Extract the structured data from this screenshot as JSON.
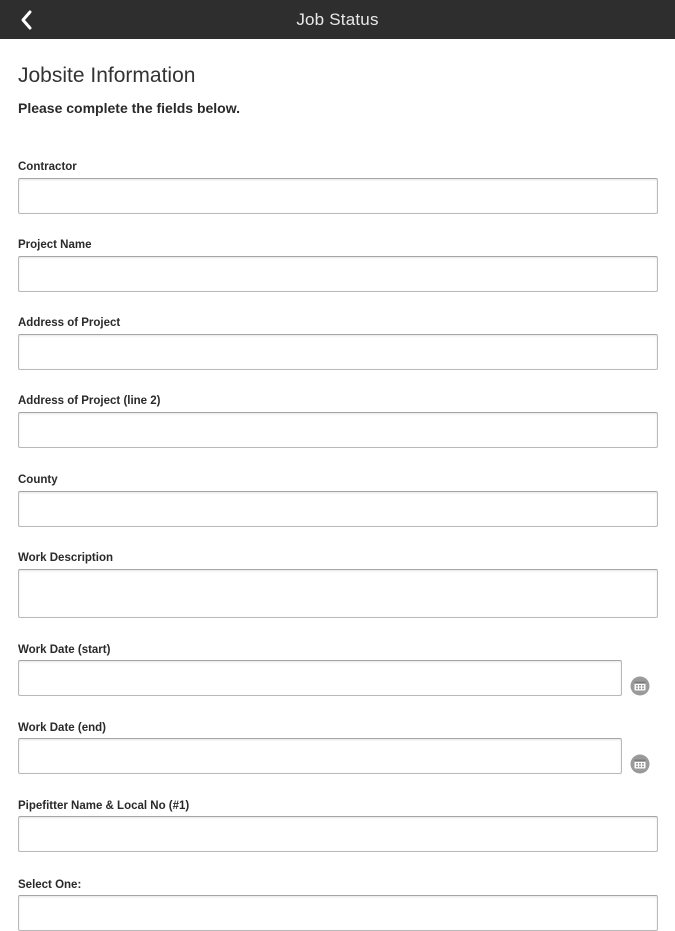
{
  "header": {
    "title": "Job Status",
    "back_icon": "chevron-left-icon"
  },
  "form": {
    "section_title": "Jobsite Information",
    "section_subtitle": "Please complete the fields below.",
    "fields": [
      {
        "label": "Contractor",
        "value": "",
        "type": "text"
      },
      {
        "label": "Project Name",
        "value": "",
        "type": "text"
      },
      {
        "label": "Address of Project",
        "value": "",
        "type": "text"
      },
      {
        "label": "Address of Project (line 2)",
        "value": "",
        "type": "text"
      },
      {
        "label": "County",
        "value": "",
        "type": "text"
      },
      {
        "label": "Work Description",
        "value": "",
        "type": "textarea"
      },
      {
        "label": "Work Date (start)",
        "value": "",
        "type": "date",
        "icon": "calendar-icon"
      },
      {
        "label": "Work Date (end)",
        "value": "",
        "type": "date",
        "icon": "calendar-icon"
      },
      {
        "label": "Pipefitter Name & Local No (#1)",
        "value": "",
        "type": "text"
      },
      {
        "label": "Select One:",
        "value": "",
        "type": "select"
      }
    ]
  },
  "colors": {
    "header_bg": "#2e2e2e",
    "header_text": "#e9e9e9",
    "input_border": "#b9b9b9",
    "icon_gray": "#9a9a9a"
  }
}
